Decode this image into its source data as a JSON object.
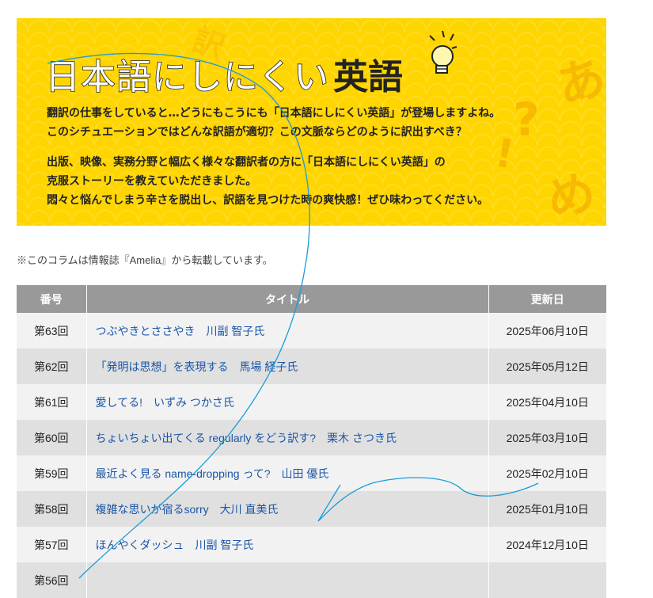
{
  "banner": {
    "title_main": "日本語にしにくい",
    "title_accent": "英語",
    "deco": {
      "a": "あ",
      "q": "?",
      "ex": "!",
      "me": "め",
      "k": "訳"
    },
    "paragraph1": [
      "翻訳の仕事をしていると…どうにもこうにも「日本語にしにくい英語」が登場しますよね。",
      "このシチュエーションではどんな訳語が適切？この文脈ならどのように訳出すべき？"
    ],
    "paragraph2": [
      "出版、映像、実務分野と幅広く様々な翻訳者の方に「日本語にしにくい英語」の",
      "克服ストーリーを教えていただきました。",
      "悶々と悩んでしまう辛さを脱出し、訳語を見つけた時の爽快感！ぜひ味わってください。"
    ]
  },
  "note": "※このコラムは情報誌『Amelia』から転載しています。",
  "table": {
    "headers": [
      "番号",
      "タイトル",
      "更新日"
    ],
    "rows": [
      {
        "num": "第63回",
        "title": "つぶやきとささやき　川副 智子氏",
        "date": "2025年06月10日"
      },
      {
        "num": "第62回",
        "title": "「発明は思想」を表現する　馬場 経子氏",
        "date": "2025年05月12日"
      },
      {
        "num": "第61回",
        "title": "愛してる!　いずみ つかさ氏",
        "date": "2025年04月10日"
      },
      {
        "num": "第60回",
        "title": "ちょいちょい出てくる regularly をどう訳す?　栗木 さつき氏",
        "date": "2025年03月10日"
      },
      {
        "num": "第59回",
        "title": "最近よく見る name-dropping って?　山田 優氏",
        "date": "2025年02月10日"
      },
      {
        "num": "第58回",
        "title": "複雑な思いが宿るsorry　大川 直美氏",
        "date": "2025年01月10日"
      },
      {
        "num": "第57回",
        "title": "ほんやくダッシュ　川副 智子氏",
        "date": "2024年12月10日"
      },
      {
        "num": "第56回",
        "title": "",
        "date": ""
      }
    ]
  }
}
